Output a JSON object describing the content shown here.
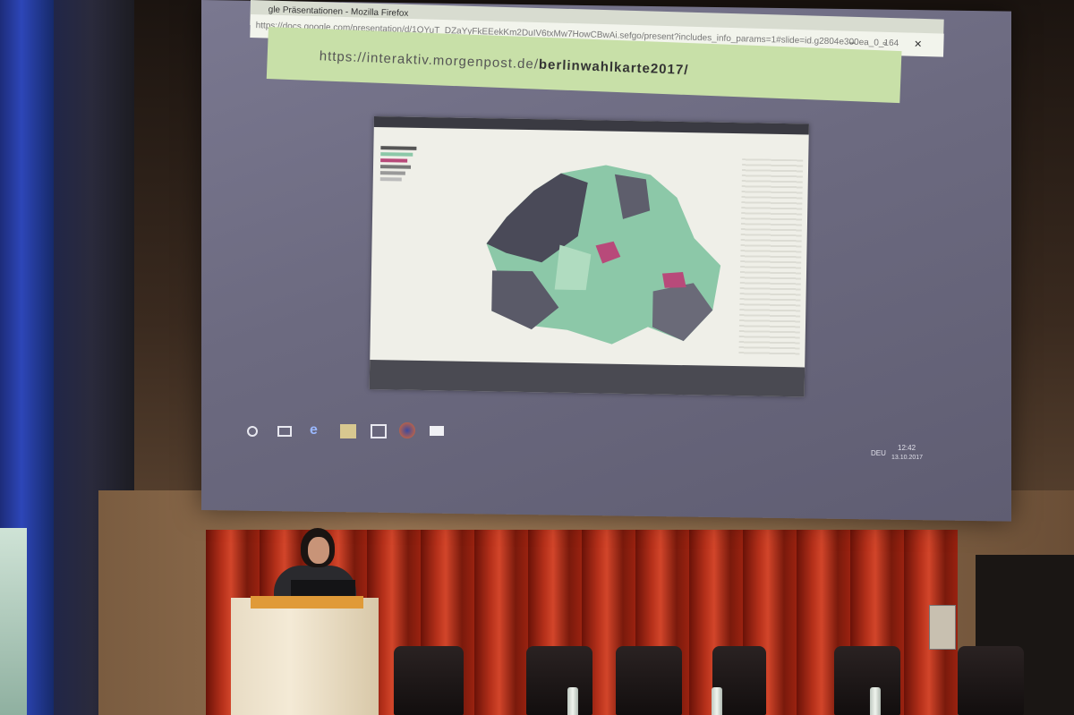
{
  "browser": {
    "window_title": "gle Präsentationen - Mozilla Firefox",
    "url": "https://docs.google.com/presentation/d/1QYuT_DZaYyFkEEekKm2DuIV6txMw7HowCBwAi.sefgo/present?includes_info_params=1#slide=id.g2804e300ea_0_164",
    "window_controls": "– ▫ ✕"
  },
  "slide": {
    "link_prefix": "https://interaktiv.morgenpost.de/",
    "link_path": "berlinwahlkarte2017/"
  },
  "colors": {
    "map_dark": "#4a4a58",
    "map_green": "#8cc8a8",
    "map_pink": "#b84a7a",
    "greenbar": "#c8e0a8"
  },
  "taskbar": {
    "icons": [
      "cortana-icon",
      "task-view-icon",
      "edge-icon",
      "file-explorer-icon",
      "store-icon",
      "firefox-icon",
      "mail-icon"
    ],
    "time": "12:42",
    "date": "13.10.2017",
    "lang": "DEU"
  }
}
